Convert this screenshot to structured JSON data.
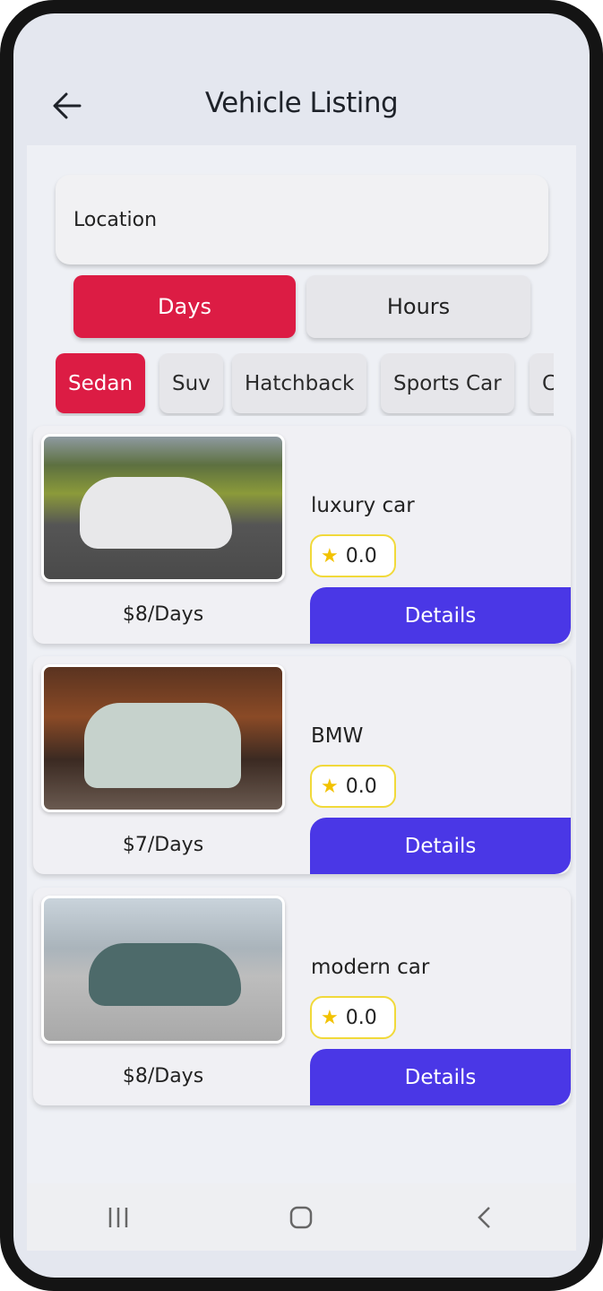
{
  "header": {
    "title": "Vehicle Listing",
    "back_icon": "arrow-left-icon"
  },
  "search": {
    "location_placeholder": "Location"
  },
  "rental_mode": {
    "options": [
      "Days",
      "Hours"
    ],
    "selected": "Days"
  },
  "categories": {
    "items": [
      "Sedan",
      "Suv",
      "Hatchback",
      "Sports Car",
      "C"
    ],
    "selected": "Sedan"
  },
  "vehicles": [
    {
      "name": "luxury car",
      "rating": "0.0",
      "price": "$8/Days",
      "button": "Details"
    },
    {
      "name": "BMW",
      "rating": "0.0",
      "price": "$7/Days",
      "button": "Details"
    },
    {
      "name": "modern car",
      "rating": "0.0",
      "price": "$8/Days",
      "button": "Details"
    }
  ],
  "colors": {
    "primary": "#dc1c44",
    "details_button": "#4a37e6",
    "star": "#f2c200"
  },
  "navbar": {
    "icons": [
      "recent-apps-icon",
      "home-icon",
      "back-icon"
    ]
  }
}
